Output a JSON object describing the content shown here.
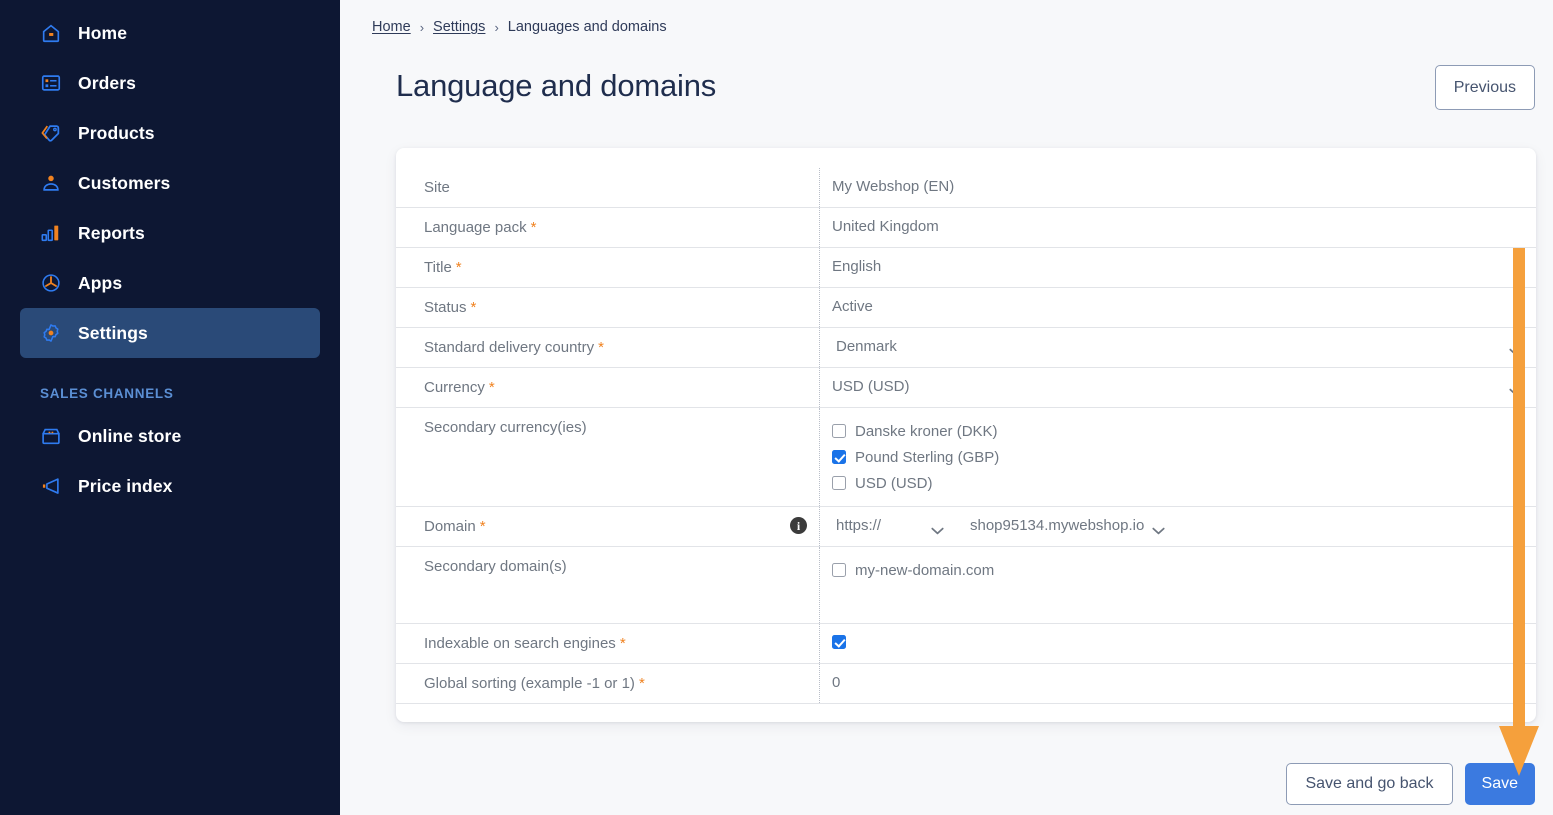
{
  "sidebar": {
    "items": [
      {
        "label": "Home",
        "icon": "home-icon",
        "active": false
      },
      {
        "label": "Orders",
        "icon": "orders-icon",
        "active": false
      },
      {
        "label": "Products",
        "icon": "products-tag-icon",
        "active": false
      },
      {
        "label": "Customers",
        "icon": "customers-person-icon",
        "active": false
      },
      {
        "label": "Reports",
        "icon": "reports-bar-chart-icon",
        "active": false
      },
      {
        "label": "Apps",
        "icon": "apps-icon",
        "active": false
      },
      {
        "label": "Settings",
        "icon": "settings-gear-icon",
        "active": true
      }
    ],
    "section_label": "SALES CHANNELS",
    "channels": [
      {
        "label": "Online store",
        "icon": "online-store-icon"
      },
      {
        "label": "Price index",
        "icon": "price-index-megaphone-icon"
      }
    ]
  },
  "header": {
    "breadcrumb": [
      {
        "label": "Home",
        "link": true
      },
      {
        "label": "Settings",
        "link": true
      },
      {
        "label": "Languages and domains",
        "link": false
      }
    ],
    "breadcrumb_separator": "›",
    "title": "Language and domains",
    "previous_label": "Previous"
  },
  "form": {
    "rows": [
      {
        "label": "Site",
        "required": false,
        "type": "text",
        "value": "My Webshop (EN)"
      },
      {
        "label": "Language pack",
        "required": true,
        "type": "text",
        "value": "United Kingdom"
      },
      {
        "label": "Title",
        "required": true,
        "type": "text",
        "value": "English"
      },
      {
        "label": "Status",
        "required": true,
        "type": "text",
        "value": "Active"
      },
      {
        "label": "Standard delivery country",
        "required": true,
        "type": "select",
        "value": "Denmark"
      },
      {
        "label": "Currency",
        "required": true,
        "type": "select",
        "value": "USD (USD)"
      },
      {
        "label": "Secondary currency(ies)",
        "required": false,
        "type": "checkbox-group",
        "options": [
          {
            "label": "Danske kroner (DKK)",
            "checked": false
          },
          {
            "label": "Pound Sterling (GBP)",
            "checked": true
          },
          {
            "label": "USD (USD)",
            "checked": false
          }
        ]
      },
      {
        "label": "Domain",
        "required": true,
        "type": "domain",
        "info": true,
        "protocol": "https://",
        "host": "shop95134.mywebshop.io"
      },
      {
        "label": "Secondary domain(s)",
        "required": false,
        "type": "checkbox-group",
        "options": [
          {
            "label": "my-new-domain.com",
            "checked": false
          }
        ]
      },
      {
        "label": "Indexable on search engines",
        "required": true,
        "type": "checkbox",
        "checked": true
      },
      {
        "label": "Global sorting (example -1 or 1)",
        "required": true,
        "type": "text",
        "value": "0"
      }
    ],
    "required_marker": "*"
  },
  "footer": {
    "save_and_go_back_label": "Save and go back",
    "save_label": "Save"
  },
  "annotation": {
    "type": "arrow",
    "color": "#f5a03c",
    "points_to": "Save"
  },
  "colors": {
    "sidebar_bg": "#0d1733",
    "sidebar_active": "#2a4a78",
    "accent_orange": "#f08220",
    "primary_blue": "#3b7ae0",
    "page_bg": "#f7f8fa",
    "checkbox_checked": "#1a73e8"
  }
}
